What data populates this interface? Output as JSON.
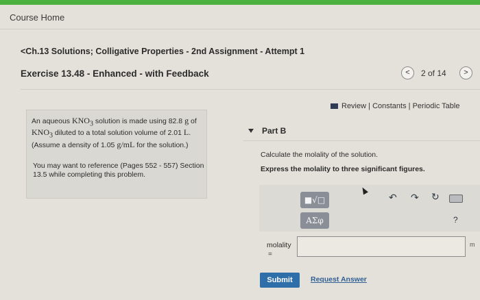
{
  "header": {
    "course_home": "Course Home",
    "breadcrumb": "<Ch.13 Solutions; Colligative Properties - 2nd Assignment - Attempt 1",
    "exercise_title": "Exercise 13.48 - Enhanced - with Feedback",
    "pager": "2 of 14",
    "prev_glyph": "<",
    "next_glyph": ">"
  },
  "resources": {
    "review": "Review",
    "sep1": " | ",
    "constants": "Constants",
    "sep2": " | ",
    "periodic_table": "Periodic Table"
  },
  "problem": {
    "p1_a": "An aqueous ",
    "kno3": "KNO",
    "sub3": "3",
    "p1_b": " solution is made using 82.8 ",
    "g1": "g",
    "p1_c": " of ",
    "p1_d": " diluted to a total solution volume of 2.01 ",
    "L": "L",
    "p1_e": ". (Assume a density of 1.05 ",
    "density_unit": "g/mL",
    "p1_f": " for the solution.)",
    "reference": "You may want to reference (Pages 552 - 557) Section 13.5 while completing this problem."
  },
  "part": {
    "label": "Part B",
    "question": "Calculate the molality of the solution.",
    "instruction": "Express the molality to three significant figures."
  },
  "toolbar": {
    "template_glyph": "■√□",
    "greek_glyph": "ΑΣφ",
    "undo_glyph": "↶",
    "redo_glyph": "↷",
    "reset_glyph": "↻",
    "help_glyph": "?"
  },
  "answer": {
    "label": "molality",
    "eq": "=",
    "value": "",
    "units_cut": "m"
  },
  "actions": {
    "submit": "Submit",
    "request_answer": "Request Answer"
  }
}
